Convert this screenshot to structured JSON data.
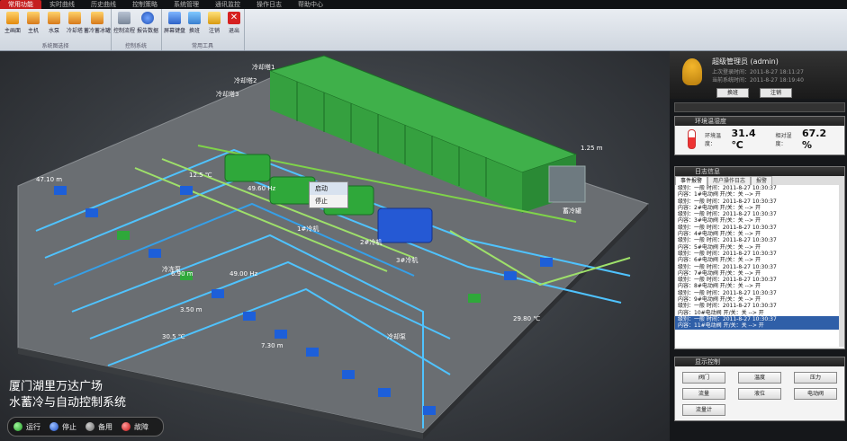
{
  "menubar": [
    "常用功能",
    "实时曲线",
    "历史曲线",
    "控制策略",
    "系统管理",
    "通讯监控",
    "操作日志",
    "帮助中心"
  ],
  "ribbon": {
    "groups": [
      {
        "label": "系统图选择",
        "buttons": [
          "主画面",
          "主机",
          "水泵",
          "冷却塔",
          "蓄冷蓄冰罐"
        ]
      },
      {
        "label": "控制系统",
        "buttons": [
          "控制流程",
          "报告数据"
        ]
      },
      {
        "label": "常用工具",
        "buttons": [
          "屏幕键盘",
          "换班",
          "注销",
          "退出"
        ]
      }
    ]
  },
  "scene": {
    "title_line1": "厦门湖里万达广场",
    "title_line2": "水蓄冷与自动控制系统",
    "context_menu": [
      "启动",
      "停止"
    ],
    "legend": [
      {
        "label": "运行",
        "color": "#2fbf3a"
      },
      {
        "label": "停止",
        "color": "#1f5fd8"
      },
      {
        "label": "备用",
        "color": "#8a8a8a"
      },
      {
        "label": "故障",
        "color": "#e02020"
      }
    ],
    "tags": [
      "冷却塔1",
      "冷却塔2",
      "冷却塔3",
      "1#冷机",
      "2#冷机",
      "3#冷机",
      "冷冻泵",
      "冷却泵",
      "蓄冷罐"
    ],
    "readings": [
      "47.10 m",
      "49.60 Hz",
      "6.90 m",
      "7.30 m",
      "30.5 ℃",
      "12.5 ℃",
      "1.25 m",
      "29.80 ℃",
      "3.50 m",
      "49.00 Hz"
    ]
  },
  "user": {
    "name": "超级管理员 (admin)",
    "login_time": "上次登录时间：2011-8-27 18:11:27",
    "current_time": "当前系统时间：2011-8-27 18:19:40",
    "btn_switch": "换班",
    "btn_logout": "注销"
  },
  "env": {
    "header": "环境温湿度",
    "temp_label": "环境温度：",
    "temp_value": "31.4 ℃",
    "hum_label": "相对湿度：",
    "hum_value": "67.2 %"
  },
  "log": {
    "header": "日志信息",
    "tabs": [
      "事件报警",
      "用户操作日志",
      "报警"
    ],
    "lines": [
      "级别：一般   时间：2011-8-27 10:30:37",
      "  内容：1#电动阀 开/关：关 --> 开",
      "级别：一般   时间：2011-8-27 10:30:37",
      "  内容：2#电动阀 开/关：关 --> 开",
      "级别：一般   时间：2011-8-27 10:30:37",
      "  内容：3#电动阀 开/关：关 --> 开",
      "级别：一般   时间：2011-8-27 10:30:37",
      "  内容：4#电动阀 开/关：关 --> 开",
      "级别：一般   时间：2011-8-27 10:30:37",
      "  内容：5#电动阀 开/关：关 --> 开",
      "级别：一般   时间：2011-8-27 10:30:37",
      "  内容：6#电动阀 开/关：关 --> 开",
      "级别：一般   时间：2011-8-27 10:30:37",
      "  内容：7#电动阀 开/关：关 --> 开",
      "级别：一般   时间：2011-8-27 10:30:37",
      "  内容：8#电动阀 开/关：关 --> 开",
      "级别：一般   时间：2011-8-27 10:30:37",
      "  内容：9#电动阀 开/关：关 --> 开",
      "级别：一般   时间：2011-8-27 10:30:37",
      "  内容：10#电动阀 开/关：关 --> 开",
      "级别：一般   时间：2011-8-27 10:30:37",
      "  内容：11#电动阀 开/关：关 --> 开"
    ]
  },
  "display_ctrl": {
    "header": "显示控制",
    "buttons": [
      "阀门",
      "温度",
      "压力",
      "流量",
      "液位",
      "电动阀",
      "流量计"
    ]
  }
}
